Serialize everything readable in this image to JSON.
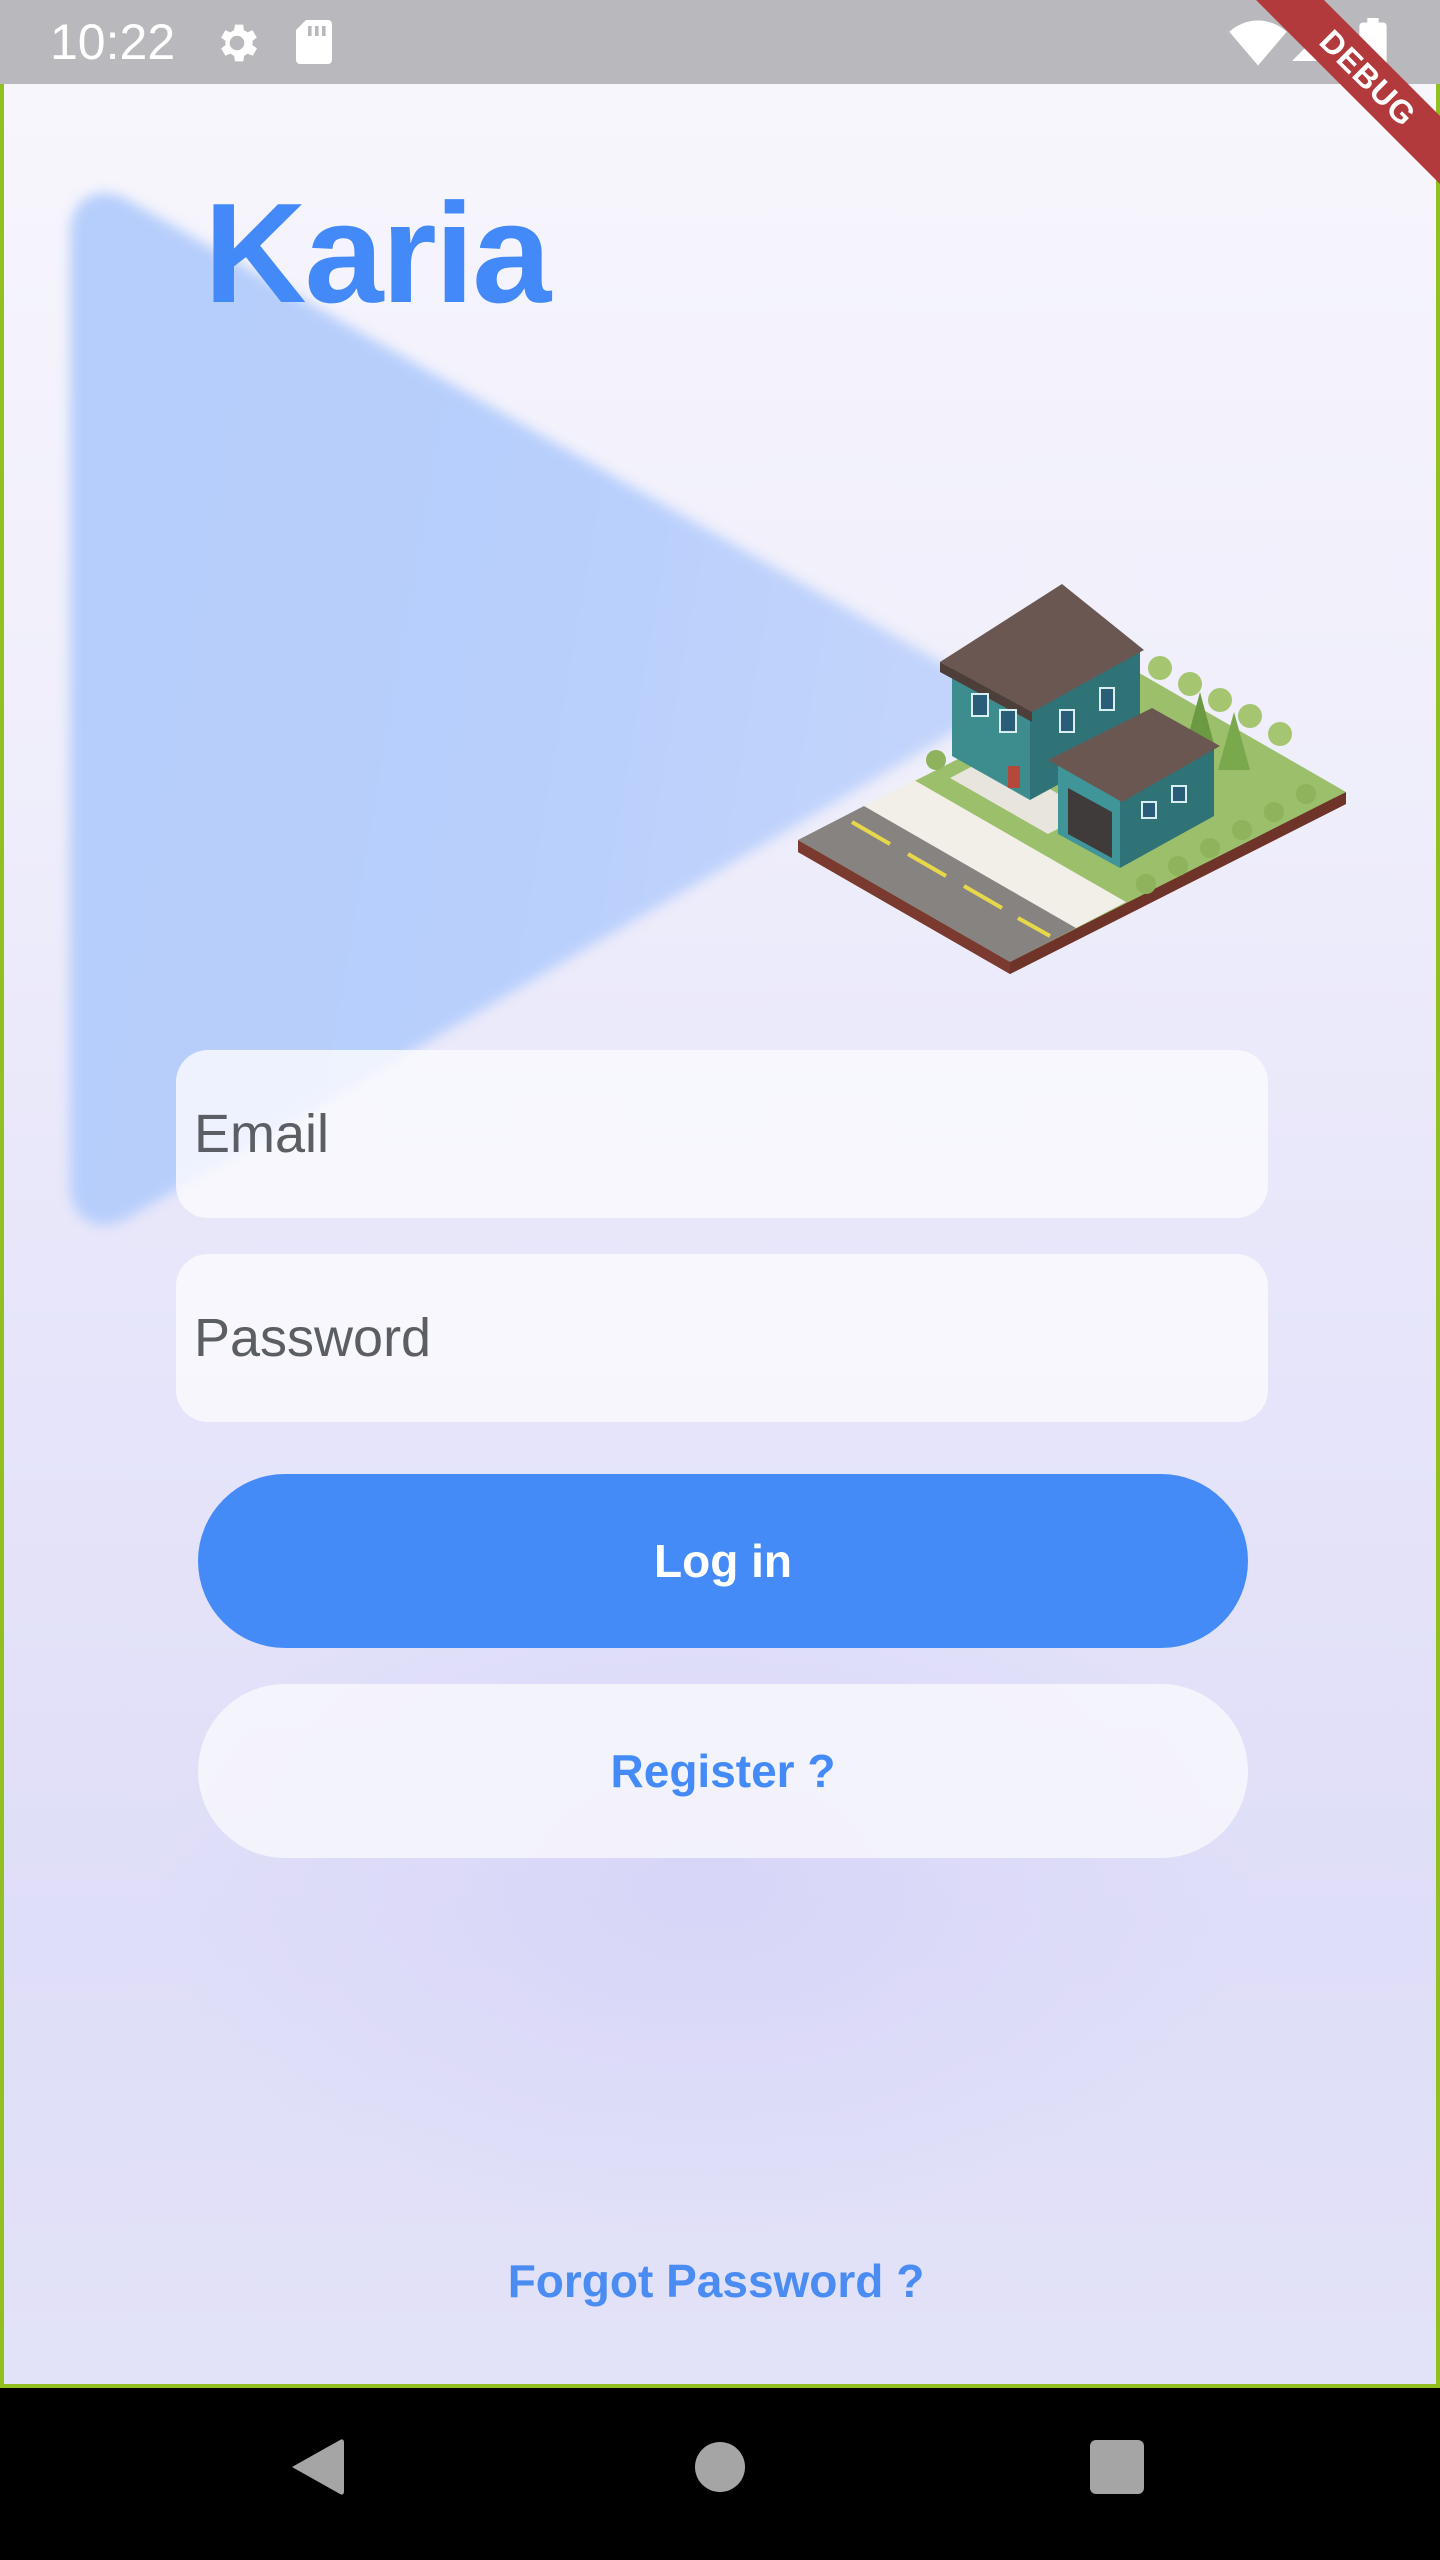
{
  "status_bar": {
    "time": "10:22",
    "icons": [
      "gear-icon",
      "sd-card-icon",
      "wifi-icon",
      "signal-icon",
      "battery-icon"
    ]
  },
  "debug_banner": {
    "label": "DEBUG",
    "color": "#b2393c"
  },
  "app": {
    "title": "Karia",
    "illustration": "house-illustration",
    "email_field": {
      "placeholder": "Email",
      "value": ""
    },
    "password_field": {
      "placeholder": "Password",
      "value": ""
    },
    "login_button": {
      "label": "Log in"
    },
    "register_button": {
      "label": "Register ?"
    },
    "forgot_password": {
      "label": "Forgot Password ?"
    }
  },
  "nav_bar": {
    "buttons": [
      "back-icon",
      "home-icon",
      "recents-icon"
    ]
  },
  "colors": {
    "accent": "#448bf8",
    "title": "#4489f8",
    "frame_border": "#93c021",
    "background_top": "#f7f6fc",
    "background_bottom": "#dfdef8"
  }
}
